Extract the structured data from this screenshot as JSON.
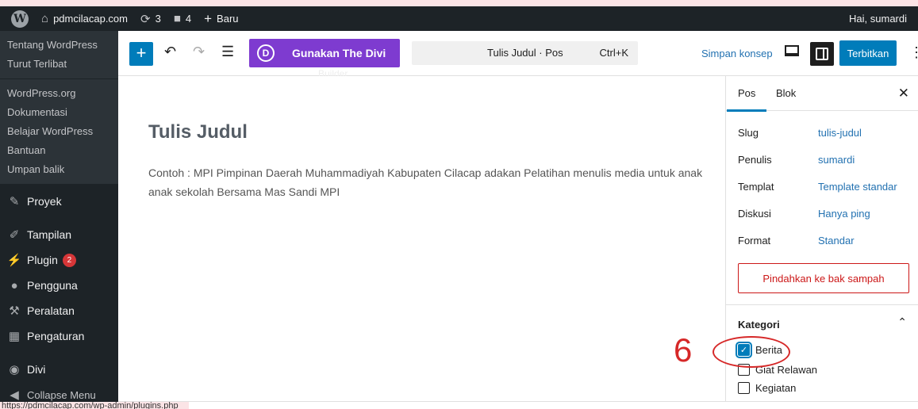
{
  "adminbar": {
    "site_name": "pdmcilacap.com",
    "updates_count": "3",
    "comments_count": "4",
    "new_label": "Baru",
    "greeting": "Hai, sumardi"
  },
  "sidebar": {
    "sub_top": [
      "Tentang WordPress",
      "Turut Terlibat"
    ],
    "sub_links": [
      "WordPress.org",
      "Dokumentasi",
      "Belajar WordPress",
      "Bantuan",
      "Umpan balik"
    ],
    "menu": [
      {
        "label": "Proyek",
        "icon": "pin-icon"
      },
      {
        "label": "Tampilan",
        "icon": "brush-icon"
      },
      {
        "label": "Plugin",
        "icon": "plugin-icon",
        "badge": "2"
      },
      {
        "label": "Pengguna",
        "icon": "user-icon"
      },
      {
        "label": "Peralatan",
        "icon": "wrench-icon"
      },
      {
        "label": "Pengaturan",
        "icon": "settings-icon"
      },
      {
        "label": "Divi",
        "icon": "divi-icon"
      },
      {
        "label": "Collapse Menu",
        "icon": "collapse-icon"
      }
    ]
  },
  "toolbar": {
    "divi_button": "Gunakan The Divi",
    "divi_under": "Builder",
    "command_title": "Tulis Judul · Pos",
    "command_shortcut": "Ctrl+K",
    "save_draft": "Simpan konsep",
    "publish": "Terbitkan"
  },
  "post": {
    "title": "Tulis Judul",
    "body": "Contoh : MPI Pimpinan Daerah Muhammadiyah Kabupaten Cilacap adakan Pelatihan menulis media untuk anak anak sekolah Bersama Mas Sandi MPI"
  },
  "panel": {
    "tab_post": "Pos",
    "tab_block": "Blok",
    "rows": [
      {
        "label": "Slug",
        "value": "tulis-judul"
      },
      {
        "label": "Penulis",
        "value": "sumardi"
      },
      {
        "label": "Templat",
        "value": "Template standar"
      },
      {
        "label": "Diskusi",
        "value": "Hanya ping"
      },
      {
        "label": "Format",
        "value": "Standar"
      }
    ],
    "trash": "Pindahkan ke bak sampah",
    "category_heading": "Kategori",
    "categories": [
      {
        "label": "Berita",
        "checked": true
      },
      {
        "label": "Giat Relawan",
        "checked": false
      },
      {
        "label": "Kegiatan",
        "checked": false
      }
    ]
  },
  "annotation": {
    "number": "6"
  },
  "statusbar": {
    "url": "https://pdmcilacap.com/wp-admin/plugins.php"
  },
  "colors": {
    "accent": "#007cba",
    "divi": "#7e3bd0",
    "danger": "#cc1818",
    "annotation": "#d62828"
  }
}
